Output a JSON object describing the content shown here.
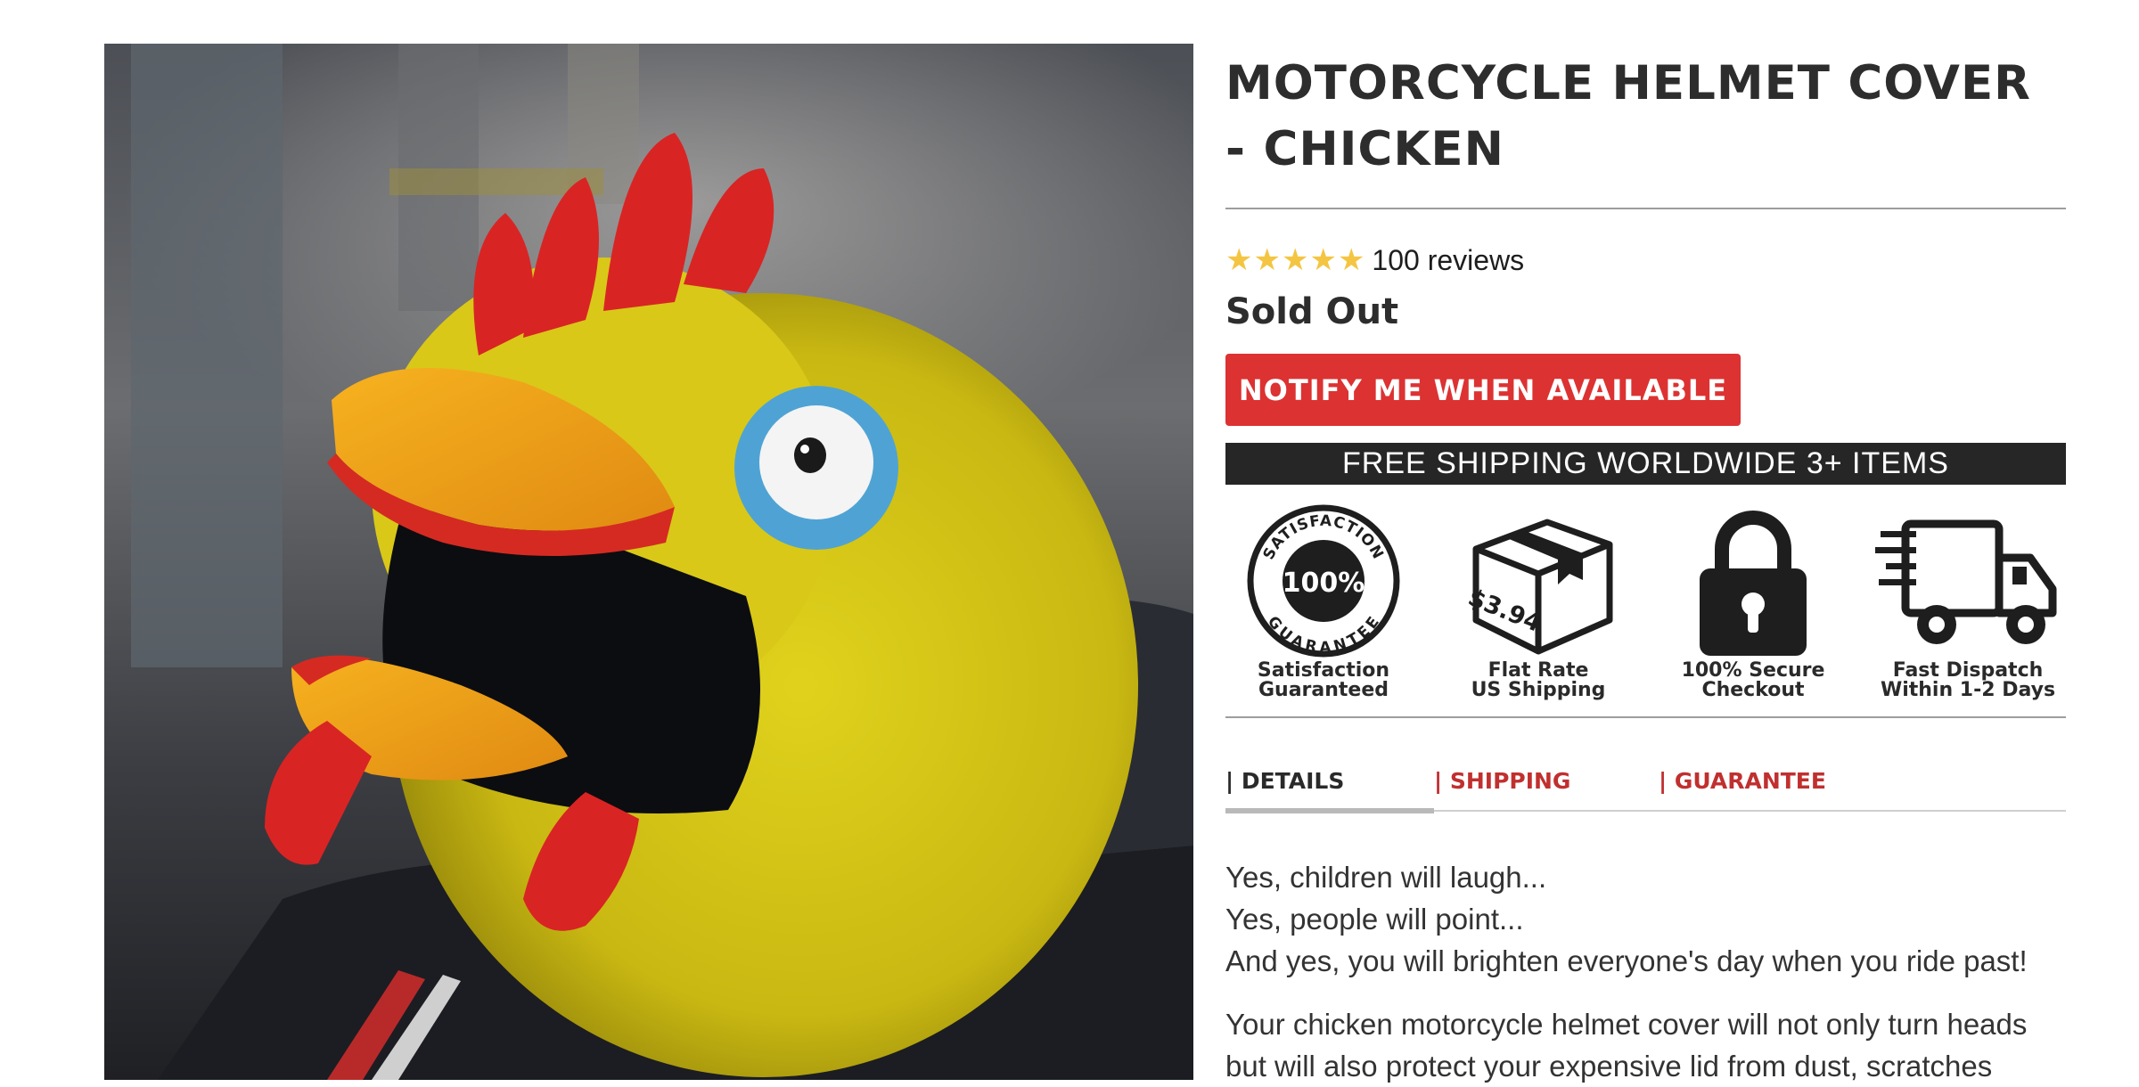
{
  "product": {
    "title": "MOTORCYCLE HELMET COVER - CHICKEN",
    "rating_stars": 5,
    "reviews_label": "100 reviews",
    "status": "Sold Out",
    "notify_label": "NOTIFY ME WHEN AVAILABLE",
    "shipping_banner": "FREE SHIPPING WORLDWIDE 3+ ITEMS"
  },
  "badges": [
    {
      "icon": "satisfaction-guarantee-seal-icon",
      "seal_top": "SATISFACTION",
      "seal_mid": "100%",
      "seal_bottom": "GUARANTEE",
      "line1": "Satisfaction",
      "line2": "Guaranteed"
    },
    {
      "icon": "shipping-box-icon",
      "price": "$3.94",
      "line1": "Flat Rate",
      "line2": "US Shipping"
    },
    {
      "icon": "padlock-icon",
      "line1": "100% Secure",
      "line2": "Checkout"
    },
    {
      "icon": "delivery-truck-icon",
      "line1": "Fast Dispatch",
      "line2": "Within 1-2 Days"
    }
  ],
  "tabs": [
    {
      "label": "| DETAILS",
      "active": true
    },
    {
      "label": "| SHIPPING",
      "active": false
    },
    {
      "label": "| GUARANTEE",
      "active": false
    }
  ],
  "description": {
    "line1": "Yes, children will laugh...",
    "line2": "Yes, people will point...",
    "line3": "And yes, you will brighten everyone's day when you ride past!",
    "para2": "Your chicken motorcycle helmet cover will not only turn heads but will also protect your expensive lid from dust, scratches"
  },
  "colors": {
    "accent_red": "#dc3232",
    "tab_red": "#c0302f",
    "star_gold": "#f4c542",
    "banner_dark": "#262626"
  }
}
